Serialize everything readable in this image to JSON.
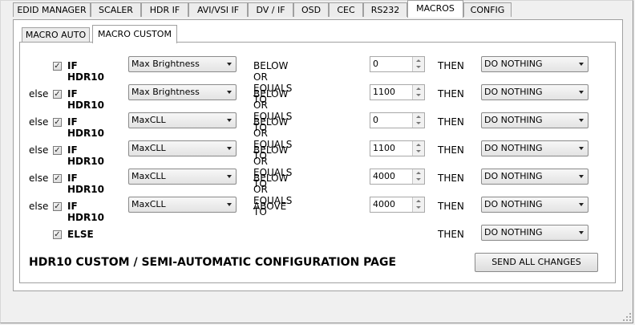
{
  "top_tabs": [
    {
      "label": "EDID MANAGER"
    },
    {
      "label": "SCALER"
    },
    {
      "label": "HDR IF"
    },
    {
      "label": "AVI/VSI IF"
    },
    {
      "label": "DV / IF"
    },
    {
      "label": "OSD"
    },
    {
      "label": "CEC"
    },
    {
      "label": "RS232"
    },
    {
      "label": "MACROS",
      "active": true
    },
    {
      "label": "CONFIG"
    }
  ],
  "sub_tabs": [
    {
      "label": "MACRO AUTO"
    },
    {
      "label": "MACRO CUSTOM",
      "active": true
    }
  ],
  "rules": [
    {
      "prefix": "",
      "checked": true,
      "condition": "IF HDR10",
      "field": "Max Brightness",
      "comparison": "BELOW OR EQUALS TO",
      "value": "0",
      "then": "THEN",
      "action": "DO NOTHING"
    },
    {
      "prefix": "else",
      "checked": true,
      "condition": "IF HDR10",
      "field": "Max Brightness",
      "comparison": "BELOW OR EQUALS TO",
      "value": "1100",
      "then": "THEN",
      "action": "DO NOTHING"
    },
    {
      "prefix": "else",
      "checked": true,
      "condition": "IF HDR10",
      "field": "MaxCLL",
      "comparison": "BELOW OR EQUALS TO",
      "value": "0",
      "then": "THEN",
      "action": "DO NOTHING"
    },
    {
      "prefix": "else",
      "checked": true,
      "condition": "IF HDR10",
      "field": "MaxCLL",
      "comparison": "BELOW OR EQUALS TO",
      "value": "1100",
      "then": "THEN",
      "action": "DO NOTHING"
    },
    {
      "prefix": "else",
      "checked": true,
      "condition": "IF HDR10",
      "field": "MaxCLL",
      "comparison": "BELOW OR EQUALS TO",
      "value": "4000",
      "then": "THEN",
      "action": "DO NOTHING"
    },
    {
      "prefix": "else",
      "checked": true,
      "condition": "IF HDR10",
      "field": "MaxCLL",
      "comparison": "ABOVE",
      "value": "4000",
      "then": "THEN",
      "action": "DO NOTHING"
    }
  ],
  "else_rule": {
    "checked": true,
    "label": "ELSE",
    "then": "THEN",
    "action": "DO NOTHING"
  },
  "page_title": "HDR10 CUSTOM / SEMI-AUTOMATIC CONFIGURATION PAGE",
  "send_button": "SEND ALL CHANGES",
  "checkmark": "✓",
  "icons": {
    "checkbox": "check-icon",
    "dropdown": "chevron-down-icon",
    "spin": "spin-arrows-icon",
    "grip": "resize-grip-icon"
  },
  "colors": {
    "panel": "#ffffff",
    "window": "#f0f0f0",
    "border": "#a0a0a0"
  }
}
